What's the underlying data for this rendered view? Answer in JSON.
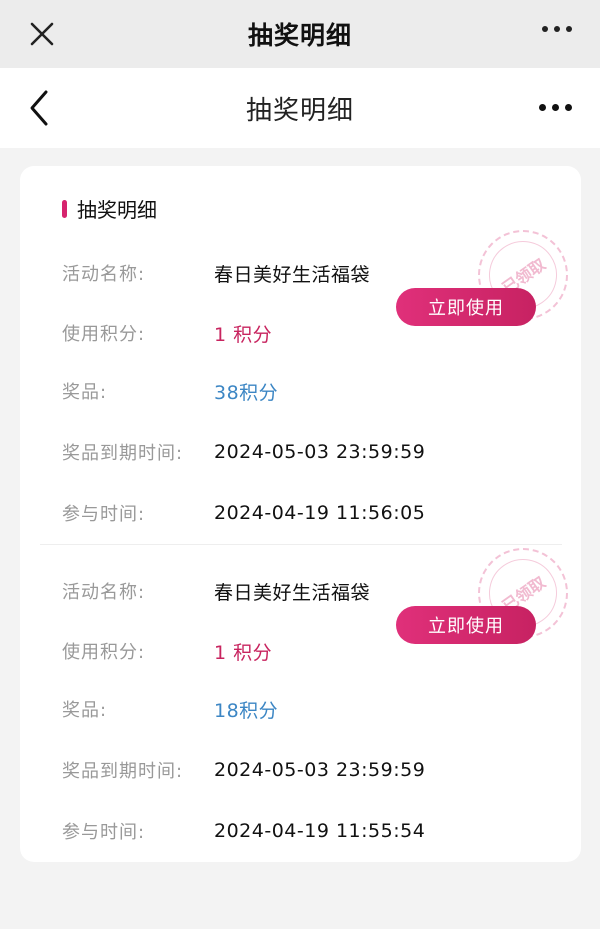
{
  "top_bar": {
    "title": "抽奖明细"
  },
  "nav_bar": {
    "title": "抽奖明细"
  },
  "section": {
    "title": "抽奖明细"
  },
  "labels": {
    "activity": "活动名称:",
    "points_used": "使用积分:",
    "prize": "奖品:",
    "prize_expiry": "奖品到期时间:",
    "join_time": "参与时间:"
  },
  "records": [
    {
      "activity": "春日美好生活福袋",
      "points_used": "1 积分",
      "prize": "38积分",
      "prize_expiry": "2024-05-03 23:59:59",
      "join_time": "2024-04-19 11:56:05",
      "button": "立即使用",
      "stamp": "已领取"
    },
    {
      "activity": "春日美好生活福袋",
      "points_used": "1 积分",
      "prize": "18积分",
      "prize_expiry": "2024-05-03 23:59:59",
      "join_time": "2024-04-19 11:55:54",
      "button": "立即使用",
      "stamp": "已领取"
    }
  ],
  "colors": {
    "accent": "#d6246e",
    "points": "#c8245f",
    "prize": "#3c86c4",
    "label": "#999999"
  }
}
